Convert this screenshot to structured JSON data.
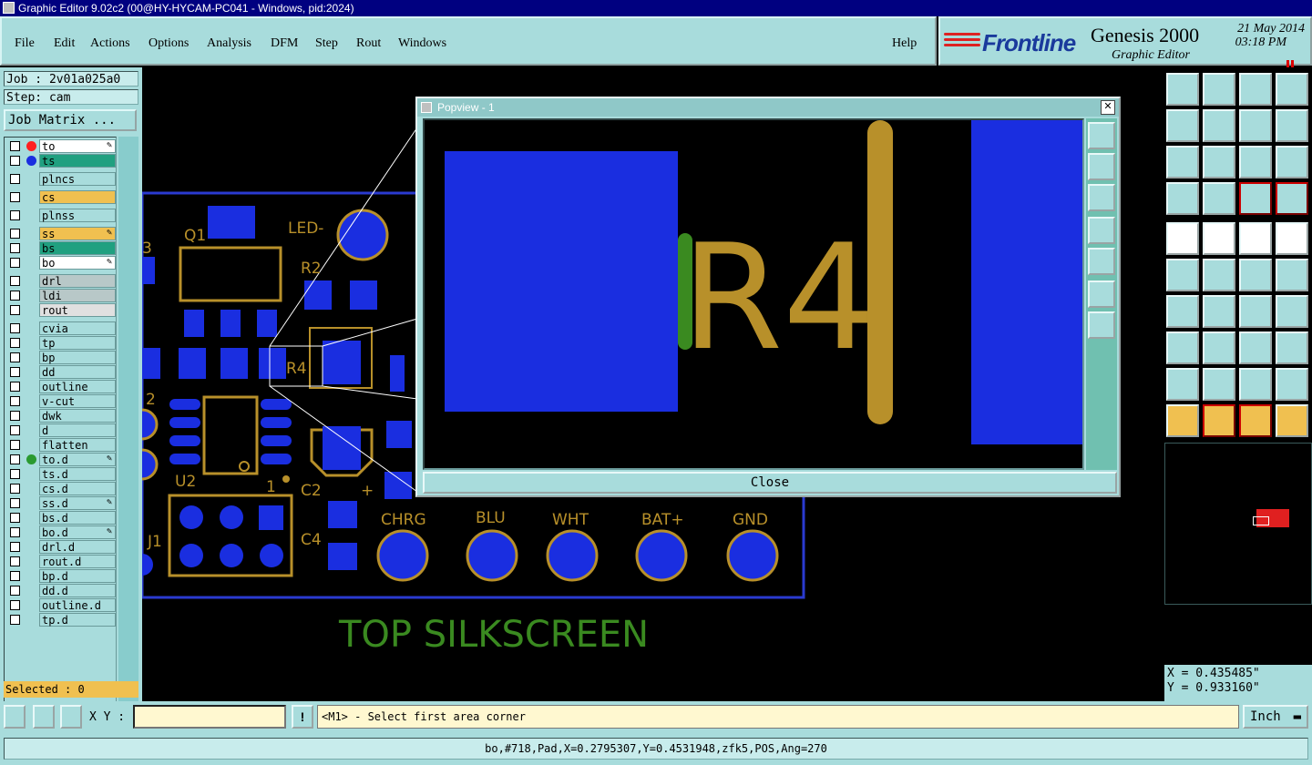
{
  "window": {
    "title": "Graphic Editor 9.02c2 (00@HY-HYCAM-PC041 - Windows, pid:2024)"
  },
  "menu": {
    "items": [
      "File",
      "Edit",
      "Actions",
      "Options",
      "Analysis",
      "DFM",
      "Step",
      "Rout",
      "Windows"
    ],
    "help": "Help"
  },
  "brand": {
    "logo": "Frontline",
    "product": "Genesis 2000",
    "subtitle": "Graphic Editor",
    "date": "21 May 2014",
    "time": "03:18 PM"
  },
  "job": {
    "job_label": "Job : 2v01a025a0",
    "step_label": "Step: cam",
    "matrix_button": "Job Matrix ..."
  },
  "layers": [
    {
      "name": "to",
      "color": "#ffffff",
      "dot": "#ff2020",
      "dot2": "#1a2ee0",
      "mark": "✎"
    },
    {
      "name": "ts",
      "color": "#20a080",
      "dot": "#1a2ee0",
      "mark": ""
    },
    {
      "name": "plncs",
      "color": "#a8dcdc",
      "dot": "",
      "mark": ""
    },
    {
      "name": "cs",
      "color": "#f0c050",
      "dot": "",
      "mark": ""
    },
    {
      "name": "plnss",
      "color": "#a8dcdc",
      "dot": "",
      "mark": ""
    },
    {
      "name": "ss",
      "color": "#f0c050",
      "dot": "",
      "mark": "✎"
    },
    {
      "name": "bs",
      "color": "#20a080",
      "dot": "",
      "mark": ""
    },
    {
      "name": "bo",
      "color": "#ffffff",
      "dot": "",
      "mark": "✎"
    },
    {
      "name": "drl",
      "color": "#b8c8c8",
      "dot": "",
      "mark": ""
    },
    {
      "name": "ldi",
      "color": "#b8c8c8",
      "dot": "",
      "mark": ""
    },
    {
      "name": "rout",
      "color": "#e0e0e0",
      "dot": "",
      "mark": ""
    },
    {
      "name": "cvia",
      "color": "#a8dcdc",
      "dot": "",
      "mark": ""
    },
    {
      "name": "tp",
      "color": "#a8dcdc",
      "dot": "",
      "mark": ""
    },
    {
      "name": "bp",
      "color": "#a8dcdc",
      "dot": "",
      "mark": ""
    },
    {
      "name": "dd",
      "color": "#a8dcdc",
      "dot": "",
      "mark": ""
    },
    {
      "name": "outline",
      "color": "#a8dcdc",
      "dot": "",
      "mark": ""
    },
    {
      "name": "v-cut",
      "color": "#a8dcdc",
      "dot": "",
      "mark": ""
    },
    {
      "name": "dwk",
      "color": "#a8dcdc",
      "dot": "",
      "mark": ""
    },
    {
      "name": "d",
      "color": "#a8dcdc",
      "dot": "",
      "mark": ""
    },
    {
      "name": "flatten",
      "color": "#a8dcdc",
      "dot": "",
      "mark": ""
    },
    {
      "name": "to.d",
      "color": "#a8dcdc",
      "dot": "#2a9a30",
      "mark": "✎"
    },
    {
      "name": "ts.d",
      "color": "#a8dcdc",
      "dot": "",
      "mark": ""
    },
    {
      "name": "cs.d",
      "color": "#a8dcdc",
      "dot": "",
      "mark": ""
    },
    {
      "name": "ss.d",
      "color": "#a8dcdc",
      "dot": "",
      "mark": "✎"
    },
    {
      "name": "bs.d",
      "color": "#a8dcdc",
      "dot": "",
      "mark": ""
    },
    {
      "name": "bo.d",
      "color": "#a8dcdc",
      "dot": "",
      "mark": "✎"
    },
    {
      "name": "drl.d",
      "color": "#a8dcdc",
      "dot": "",
      "mark": ""
    },
    {
      "name": "rout.d",
      "color": "#a8dcdc",
      "dot": "",
      "mark": ""
    },
    {
      "name": "bp.d",
      "color": "#a8dcdc",
      "dot": "",
      "mark": ""
    },
    {
      "name": "dd.d",
      "color": "#a8dcdc",
      "dot": "",
      "mark": ""
    },
    {
      "name": "outline.d",
      "color": "#a8dcdc",
      "dot": "",
      "mark": ""
    },
    {
      "name": "tp.d",
      "color": "#a8dcdc",
      "dot": "",
      "mark": ""
    }
  ],
  "selected": "Selected : 0",
  "board": {
    "refdes": [
      "Q1",
      "LED-",
      "R2",
      "R4",
      "U2",
      "J1",
      "C2",
      "C4",
      "3",
      "2",
      "1",
      "+"
    ],
    "pads": [
      "CHRG",
      "BLU",
      "WHT",
      "BAT+",
      "GND"
    ],
    "silk_label": "TOP SILKSCREEN"
  },
  "popview": {
    "title": "Popview - 1",
    "label": "R4",
    "close": "Close"
  },
  "coords": {
    "x": "X = 0.435485\"",
    "y": "Y = 0.933160\""
  },
  "bottom": {
    "xy_label": "X Y :",
    "xy_value": "",
    "prompt": "<M1> - Select first area corner",
    "units": "Inch"
  },
  "status": "bo,#718,Pad,X=0.2795307,Y=0.4531948,zfk5,POS,Ang=270",
  "colors": {
    "panel": "#a8dcdc",
    "copper": "#1a2ee0",
    "silk": "#b8902a",
    "silk_green": "#3a8a20"
  }
}
